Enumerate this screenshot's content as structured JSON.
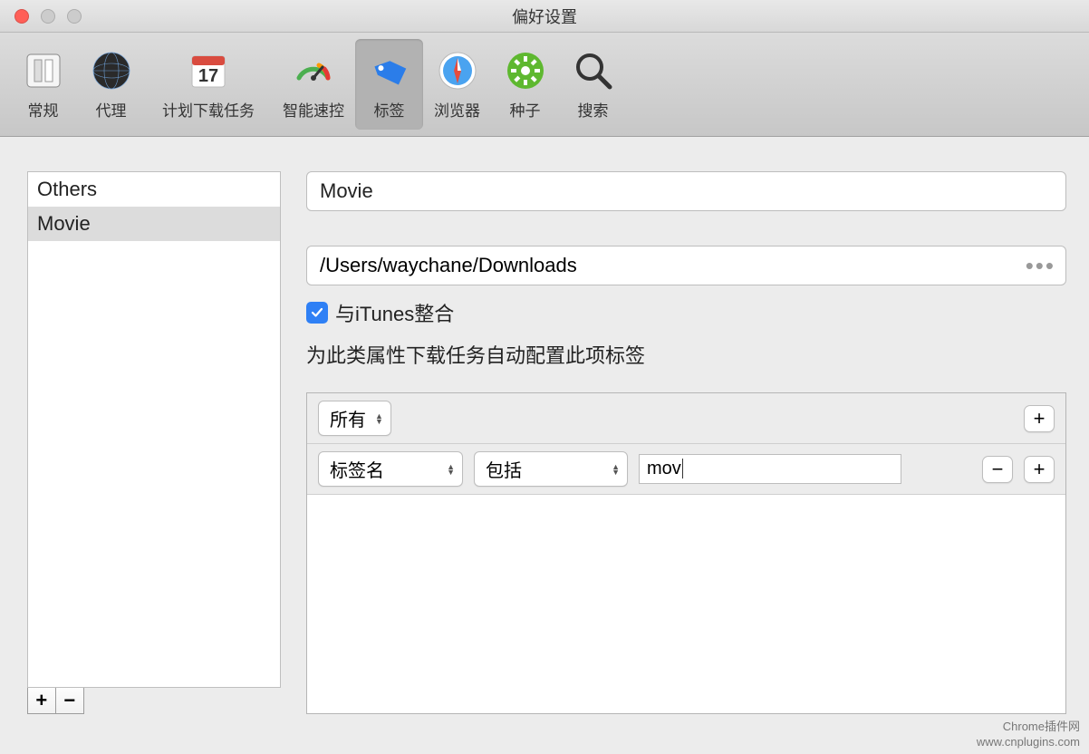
{
  "window": {
    "title": "偏好设置"
  },
  "toolbar": [
    {
      "id": "general",
      "label": "常规"
    },
    {
      "id": "proxy",
      "label": "代理"
    },
    {
      "id": "scheduler",
      "label": "计划下载任务"
    },
    {
      "id": "speed",
      "label": "智能速控"
    },
    {
      "id": "tags",
      "label": "标签",
      "selected": true
    },
    {
      "id": "browser",
      "label": "浏览器"
    },
    {
      "id": "seed",
      "label": "种子"
    },
    {
      "id": "search",
      "label": "搜索"
    }
  ],
  "sidebar": {
    "items": [
      {
        "label": "Others"
      },
      {
        "label": "Movie",
        "selected": true
      }
    ]
  },
  "form": {
    "name": "Movie",
    "path": "/Users/waychane/Downloads",
    "itunes_label": "与iTunes整合",
    "itunes_checked": true,
    "description": "为此类属性下载任务自动配置此项标签"
  },
  "rules": {
    "scope_select": "所有",
    "row": {
      "field_select": "标签名",
      "op_select": "包括",
      "value": "mov"
    }
  },
  "footer": {
    "line1": "Chrome插件网",
    "line2": "www.cnplugins.com"
  }
}
